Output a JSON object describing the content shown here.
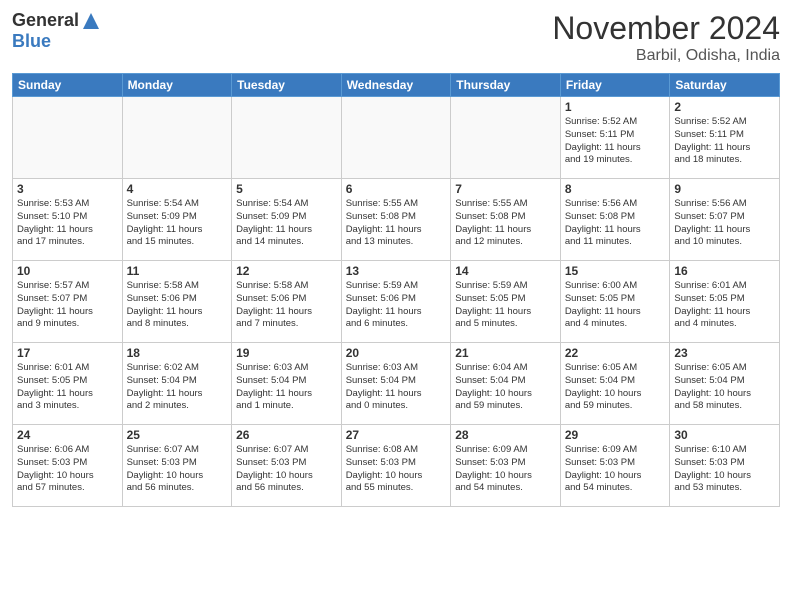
{
  "header": {
    "logo_general": "General",
    "logo_blue": "Blue",
    "month_title": "November 2024",
    "location": "Barbil, Odisha, India"
  },
  "weekdays": [
    "Sunday",
    "Monday",
    "Tuesday",
    "Wednesday",
    "Thursday",
    "Friday",
    "Saturday"
  ],
  "weeks": [
    [
      {
        "day": "",
        "info": ""
      },
      {
        "day": "",
        "info": ""
      },
      {
        "day": "",
        "info": ""
      },
      {
        "day": "",
        "info": ""
      },
      {
        "day": "",
        "info": ""
      },
      {
        "day": "1",
        "info": "Sunrise: 5:52 AM\nSunset: 5:11 PM\nDaylight: 11 hours\nand 19 minutes."
      },
      {
        "day": "2",
        "info": "Sunrise: 5:52 AM\nSunset: 5:11 PM\nDaylight: 11 hours\nand 18 minutes."
      }
    ],
    [
      {
        "day": "3",
        "info": "Sunrise: 5:53 AM\nSunset: 5:10 PM\nDaylight: 11 hours\nand 17 minutes."
      },
      {
        "day": "4",
        "info": "Sunrise: 5:54 AM\nSunset: 5:09 PM\nDaylight: 11 hours\nand 15 minutes."
      },
      {
        "day": "5",
        "info": "Sunrise: 5:54 AM\nSunset: 5:09 PM\nDaylight: 11 hours\nand 14 minutes."
      },
      {
        "day": "6",
        "info": "Sunrise: 5:55 AM\nSunset: 5:08 PM\nDaylight: 11 hours\nand 13 minutes."
      },
      {
        "day": "7",
        "info": "Sunrise: 5:55 AM\nSunset: 5:08 PM\nDaylight: 11 hours\nand 12 minutes."
      },
      {
        "day": "8",
        "info": "Sunrise: 5:56 AM\nSunset: 5:08 PM\nDaylight: 11 hours\nand 11 minutes."
      },
      {
        "day": "9",
        "info": "Sunrise: 5:56 AM\nSunset: 5:07 PM\nDaylight: 11 hours\nand 10 minutes."
      }
    ],
    [
      {
        "day": "10",
        "info": "Sunrise: 5:57 AM\nSunset: 5:07 PM\nDaylight: 11 hours\nand 9 minutes."
      },
      {
        "day": "11",
        "info": "Sunrise: 5:58 AM\nSunset: 5:06 PM\nDaylight: 11 hours\nand 8 minutes."
      },
      {
        "day": "12",
        "info": "Sunrise: 5:58 AM\nSunset: 5:06 PM\nDaylight: 11 hours\nand 7 minutes."
      },
      {
        "day": "13",
        "info": "Sunrise: 5:59 AM\nSunset: 5:06 PM\nDaylight: 11 hours\nand 6 minutes."
      },
      {
        "day": "14",
        "info": "Sunrise: 5:59 AM\nSunset: 5:05 PM\nDaylight: 11 hours\nand 5 minutes."
      },
      {
        "day": "15",
        "info": "Sunrise: 6:00 AM\nSunset: 5:05 PM\nDaylight: 11 hours\nand 4 minutes."
      },
      {
        "day": "16",
        "info": "Sunrise: 6:01 AM\nSunset: 5:05 PM\nDaylight: 11 hours\nand 4 minutes."
      }
    ],
    [
      {
        "day": "17",
        "info": "Sunrise: 6:01 AM\nSunset: 5:05 PM\nDaylight: 11 hours\nand 3 minutes."
      },
      {
        "day": "18",
        "info": "Sunrise: 6:02 AM\nSunset: 5:04 PM\nDaylight: 11 hours\nand 2 minutes."
      },
      {
        "day": "19",
        "info": "Sunrise: 6:03 AM\nSunset: 5:04 PM\nDaylight: 11 hours\nand 1 minute."
      },
      {
        "day": "20",
        "info": "Sunrise: 6:03 AM\nSunset: 5:04 PM\nDaylight: 11 hours\nand 0 minutes."
      },
      {
        "day": "21",
        "info": "Sunrise: 6:04 AM\nSunset: 5:04 PM\nDaylight: 10 hours\nand 59 minutes."
      },
      {
        "day": "22",
        "info": "Sunrise: 6:05 AM\nSunset: 5:04 PM\nDaylight: 10 hours\nand 59 minutes."
      },
      {
        "day": "23",
        "info": "Sunrise: 6:05 AM\nSunset: 5:04 PM\nDaylight: 10 hours\nand 58 minutes."
      }
    ],
    [
      {
        "day": "24",
        "info": "Sunrise: 6:06 AM\nSunset: 5:03 PM\nDaylight: 10 hours\nand 57 minutes."
      },
      {
        "day": "25",
        "info": "Sunrise: 6:07 AM\nSunset: 5:03 PM\nDaylight: 10 hours\nand 56 minutes."
      },
      {
        "day": "26",
        "info": "Sunrise: 6:07 AM\nSunset: 5:03 PM\nDaylight: 10 hours\nand 56 minutes."
      },
      {
        "day": "27",
        "info": "Sunrise: 6:08 AM\nSunset: 5:03 PM\nDaylight: 10 hours\nand 55 minutes."
      },
      {
        "day": "28",
        "info": "Sunrise: 6:09 AM\nSunset: 5:03 PM\nDaylight: 10 hours\nand 54 minutes."
      },
      {
        "day": "29",
        "info": "Sunrise: 6:09 AM\nSunset: 5:03 PM\nDaylight: 10 hours\nand 54 minutes."
      },
      {
        "day": "30",
        "info": "Sunrise: 6:10 AM\nSunset: 5:03 PM\nDaylight: 10 hours\nand 53 minutes."
      }
    ]
  ]
}
